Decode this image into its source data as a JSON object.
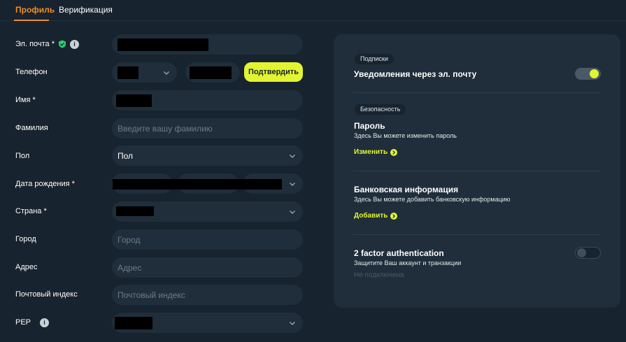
{
  "tabs": [
    {
      "label": "Профиль",
      "active": true
    },
    {
      "label": "Верификация",
      "active": false
    }
  ],
  "form": {
    "email_label": "Эл. почта *",
    "phone_label": "Телефон",
    "confirm_button": "Подтвердить",
    "first_name_label": "Имя *",
    "last_name_label": "Фамилия",
    "last_name_placeholder": "Введите вашу фамилию",
    "gender_label": "Пол",
    "gender_value": "Пол",
    "birthdate_label": "Дата рождения *",
    "country_label": "Страна *",
    "city_label": "Город",
    "city_placeholder": "Город",
    "address_label": "Адрес",
    "address_placeholder": "Адрес",
    "postal_label": "Почтовый индекс",
    "postal_placeholder": "Почтовый индекс",
    "pep_label": "PEP"
  },
  "panel": {
    "subscriptions_chip": "Подписки",
    "email_notifications": "Уведомления через эл. почту",
    "email_notifications_on": true,
    "security_chip": "Безопасность",
    "password_title": "Пароль",
    "password_sub": "Здесь Вы можете изменить пароль",
    "password_link": "Изменить",
    "bank_title": "Банковская информация",
    "bank_sub": "Здесь Вы можете добавить банковскую информацию",
    "bank_link": "Добавить",
    "twofa_title": "2 factor authentication",
    "twofa_sub": "Защитите Ваш аккаунт и транзакции",
    "twofa_status": "Не подключена",
    "twofa_on": false
  },
  "colors": {
    "accent_orange": "#f28c28",
    "accent_lime": "#e2f531",
    "background": "#17232e",
    "surface": "#1f2e3a"
  }
}
